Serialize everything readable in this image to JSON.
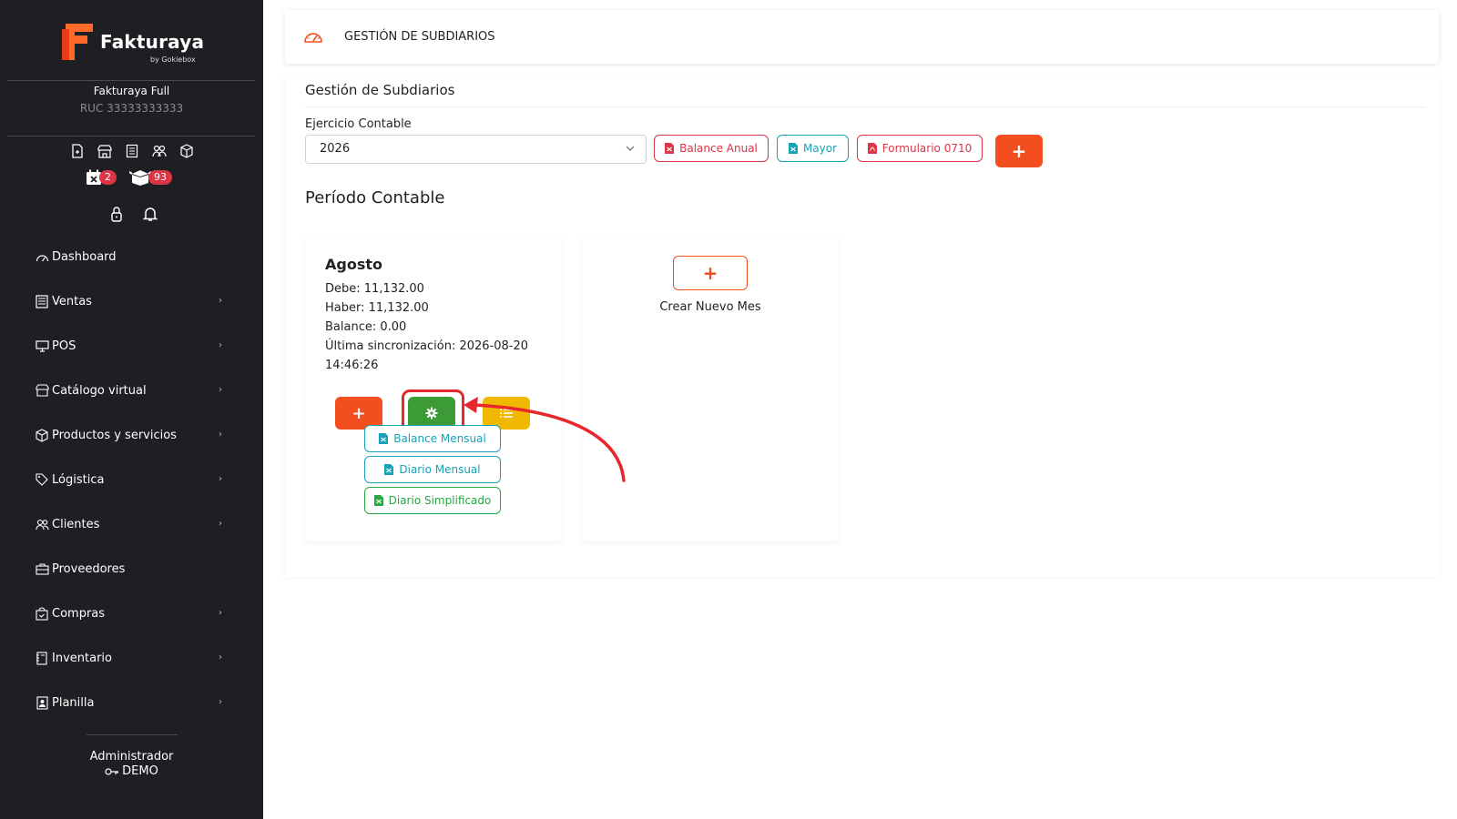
{
  "brand": {
    "name_part1": "Fakturaya",
    "name_part2": "",
    "by": "by Gokiebox",
    "accent": "#ff6a2b"
  },
  "company": {
    "name": "Fakturaya Full",
    "ruc": "RUC 33333333333"
  },
  "badges": {
    "calendar_count": "2",
    "inbox_count": "93"
  },
  "sidebar": {
    "items": [
      {
        "label": "Dashboard",
        "icon": "dashboard-icon",
        "has_children": false
      },
      {
        "label": "Ventas",
        "icon": "sales-icon",
        "has_children": true
      },
      {
        "label": "POS",
        "icon": "monitor-icon",
        "has_children": true
      },
      {
        "label": "Catálogo virtual",
        "icon": "store-icon",
        "has_children": true
      },
      {
        "label": "Productos y servicios",
        "icon": "box-icon",
        "has_children": true
      },
      {
        "label": "Lógistica",
        "icon": "tag-icon",
        "has_children": true
      },
      {
        "label": "Clientes",
        "icon": "users-icon",
        "has_children": true
      },
      {
        "label": "Proveedores",
        "icon": "briefcase-icon",
        "has_children": false
      },
      {
        "label": "Compras",
        "icon": "shopping-bag-icon",
        "has_children": true
      },
      {
        "label": "Inventario",
        "icon": "inventory-icon",
        "has_children": true
      },
      {
        "label": "Planilla",
        "icon": "payroll-icon",
        "has_children": true
      }
    ]
  },
  "user": {
    "role": "Administrador",
    "name": "DEMO"
  },
  "header": {
    "title": "GESTIÓN DE SUBDIARIOS"
  },
  "main": {
    "title": "Gestión de Subdiarios",
    "ejercicio_label": "Ejercicio Contable",
    "ejercicio_value": "2026",
    "buttons": {
      "balance_anual": "Balance Anual",
      "mayor": "Mayor",
      "formulario": "Formulario 0710",
      "add": "+"
    },
    "periodo_title": "Período Contable",
    "card": {
      "month": "Agosto",
      "debe": "Debe: 11,132.00",
      "haber": "Haber: 11,132.00",
      "balance": "Balance: 0.00",
      "sync_line1": "Última sincronización: 2026-08-20",
      "sync_line2": "14:46:26",
      "add": "+",
      "exports": {
        "balance_mensual": "Balance Mensual",
        "diario_mensual": "Diario Mensual",
        "diario_simplificado": "Diario Simplificado"
      }
    },
    "new_month": {
      "button": "+",
      "label": "Crear Nuevo Mes"
    }
  },
  "colors": {
    "sidebar_bg": "#1e1f23",
    "primary_orange": "#f24e1e",
    "success_green": "#3c9a37",
    "warning_yellow": "#f0b800",
    "danger_red": "#dc3545",
    "info_teal": "#17a2b8",
    "highlight_red": "#e8272c"
  }
}
